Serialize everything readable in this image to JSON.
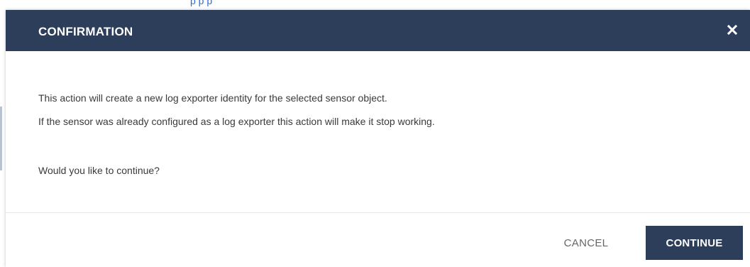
{
  "background": {
    "link_text": "p p p"
  },
  "dialog": {
    "title": "CONFIRMATION",
    "close_icon": "close-icon",
    "message_line_1": "This action will create a new log exporter identity for the selected sensor object.",
    "message_line_2": "If the sensor was already configured as a log exporter this action will make it stop working.",
    "question": "Would you like to continue?",
    "cancel_label": "CANCEL",
    "continue_label": "CONTINUE"
  },
  "colors": {
    "header_bg": "#2c3e5a",
    "primary_button": "#2c3e5a",
    "text": "#3a3a3a",
    "link": "#2f6bd8"
  }
}
